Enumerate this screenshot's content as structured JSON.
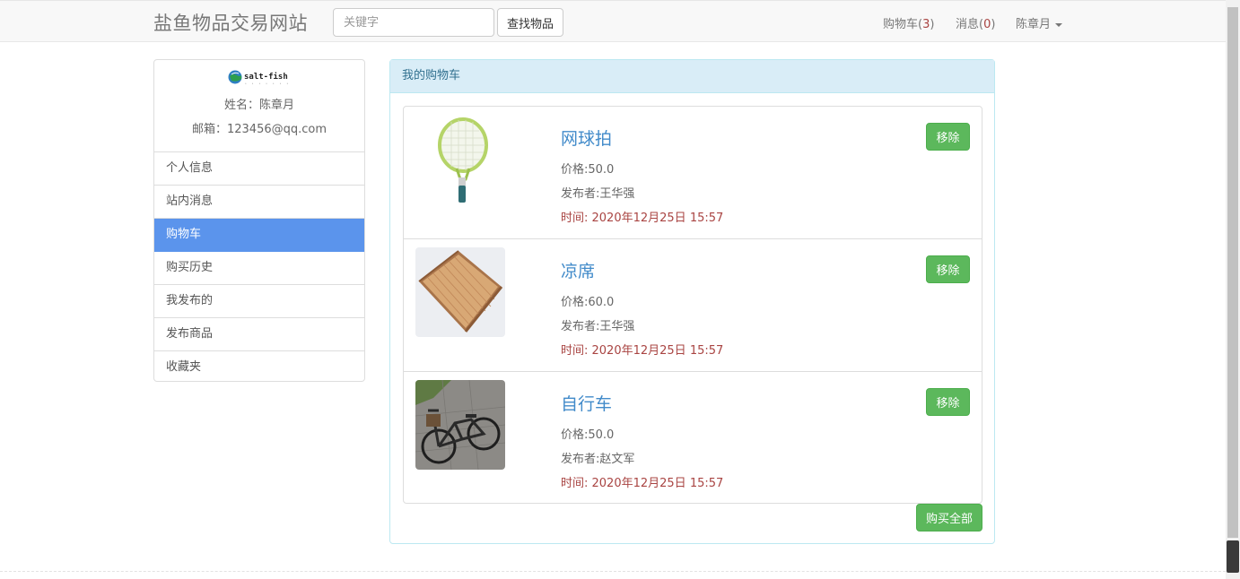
{
  "navbar": {
    "brand": "盐鱼物品交易网站",
    "search_placeholder": "关键字",
    "search_button": "查找物品",
    "cart_label": "购物车(",
    "cart_count": "3",
    "cart_suffix": ")",
    "messages_label": "消息(",
    "messages_count": "0",
    "messages_suffix": ")",
    "user_menu": "陈章月"
  },
  "sidebar": {
    "logo_text": "salt-fish",
    "name_line": "姓名：陈章月",
    "email_line": "邮箱：123456@qq.com",
    "items": [
      {
        "label": "个人信息"
      },
      {
        "label": "站内消息"
      },
      {
        "label": "购物车"
      },
      {
        "label": "购买历史"
      },
      {
        "label": "我发布的"
      },
      {
        "label": "发布商品"
      },
      {
        "label": "收藏夹"
      }
    ],
    "active_index": 2
  },
  "panel": {
    "heading": "我的购物车",
    "items": [
      {
        "title": "网球拍",
        "price": "价格:50.0",
        "seller": "发布者:王华强",
        "time": "时间:   2020年12月25日 15:57",
        "remove": "移除",
        "image": "tennis-racket-image"
      },
      {
        "title": "凉席",
        "price": "价格:60.0",
        "seller": "发布者:王华强",
        "time": "时间:   2020年12月25日 15:57",
        "remove": "移除",
        "image": "bamboo-mat-image"
      },
      {
        "title": "自行车",
        "price": "价格:50.0",
        "seller": "发布者:赵文军",
        "time": "时间:   2020年12月25日 15:57",
        "remove": "移除",
        "image": "bicycle-image"
      }
    ],
    "buy_all": "购买全部"
  },
  "colors": {
    "active": "#5b94ec",
    "success": "#5cb85c",
    "link": "#428bca",
    "danger_text": "#a94442",
    "panel_heading_bg": "#d9edf7"
  }
}
